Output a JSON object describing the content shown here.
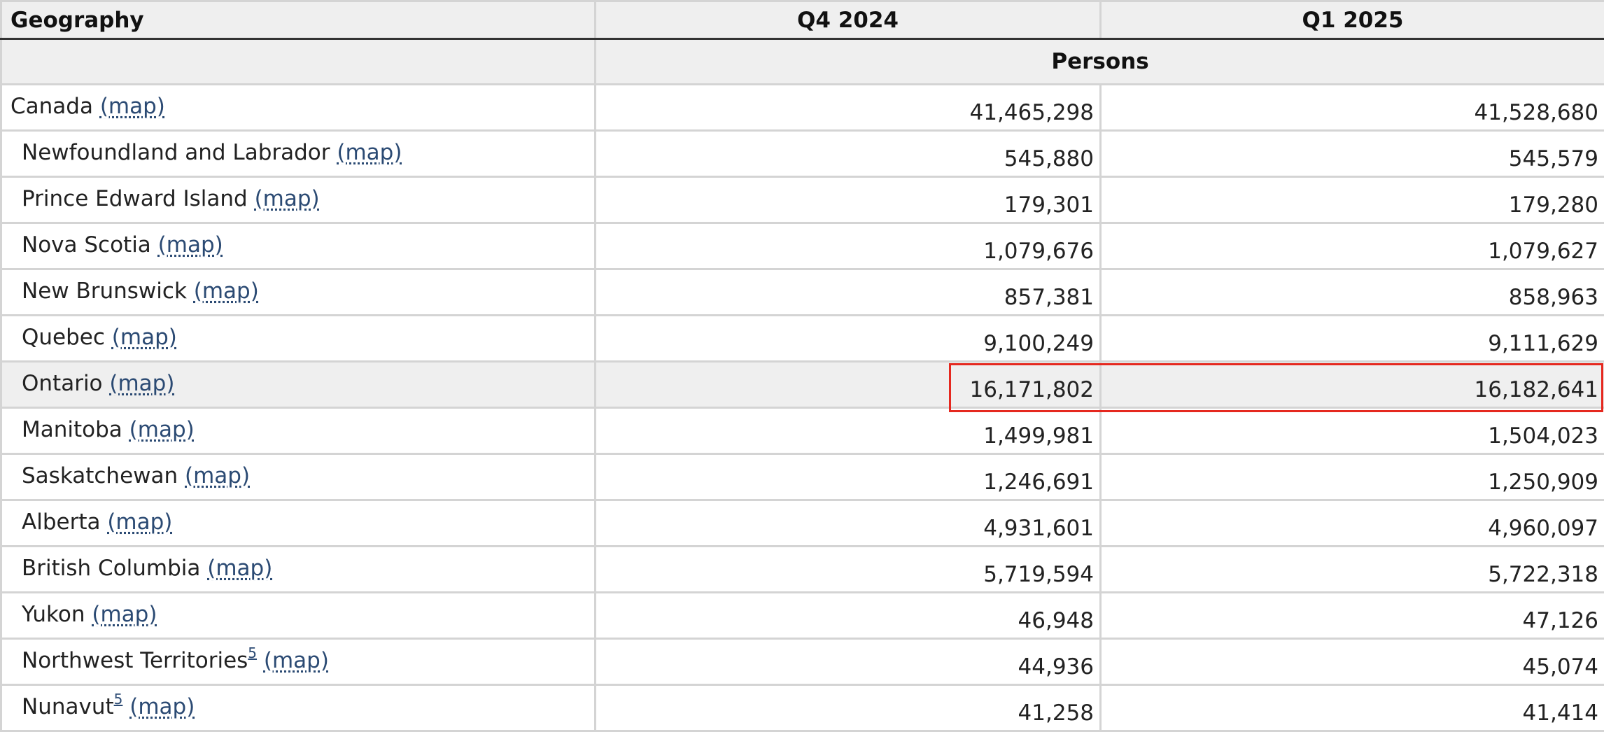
{
  "table": {
    "headers": {
      "geography": "Geography",
      "periods": [
        "Q4 2024",
        "Q1 2025"
      ],
      "units": "Persons"
    },
    "map_link_text": "(map)",
    "rows": [
      {
        "name": "Canada",
        "footnote": "",
        "q4_2024": "41,465,298",
        "q1_2025": "41,528,680"
      },
      {
        "name": "Newfoundland and Labrador",
        "footnote": "",
        "q4_2024": "545,880",
        "q1_2025": "545,579"
      },
      {
        "name": "Prince Edward Island",
        "footnote": "",
        "q4_2024": "179,301",
        "q1_2025": "179,280"
      },
      {
        "name": "Nova Scotia",
        "footnote": "",
        "q4_2024": "1,079,676",
        "q1_2025": "1,079,627"
      },
      {
        "name": "New Brunswick",
        "footnote": "",
        "q4_2024": "857,381",
        "q1_2025": "858,963"
      },
      {
        "name": "Quebec",
        "footnote": "",
        "q4_2024": "9,100,249",
        "q1_2025": "9,111,629"
      },
      {
        "name": "Ontario",
        "footnote": "",
        "q4_2024": "16,171,802",
        "q1_2025": "16,182,641"
      },
      {
        "name": "Manitoba",
        "footnote": "",
        "q4_2024": "1,499,981",
        "q1_2025": "1,504,023"
      },
      {
        "name": "Saskatchewan",
        "footnote": "",
        "q4_2024": "1,246,691",
        "q1_2025": "1,250,909"
      },
      {
        "name": "Alberta",
        "footnote": "",
        "q4_2024": "4,931,601",
        "q1_2025": "4,960,097"
      },
      {
        "name": "British Columbia",
        "footnote": "",
        "q4_2024": "5,719,594",
        "q1_2025": "5,722,318"
      },
      {
        "name": "Yukon",
        "footnote": "",
        "q4_2024": "46,948",
        "q1_2025": "47,126"
      },
      {
        "name": "Northwest Territories",
        "footnote": "5",
        "q4_2024": "44,936",
        "q1_2025": "45,074"
      },
      {
        "name": "Nunavut",
        "footnote": "5",
        "q4_2024": "41,258",
        "q1_2025": "41,414"
      }
    ],
    "selected_row": "Ontario"
  },
  "colors": {
    "link": "#2b4a73",
    "header_bg": "#efefef",
    "selected_row_bg": "#efefef",
    "highlight_border": "#e5281f",
    "grid": "#d4d4d4"
  }
}
